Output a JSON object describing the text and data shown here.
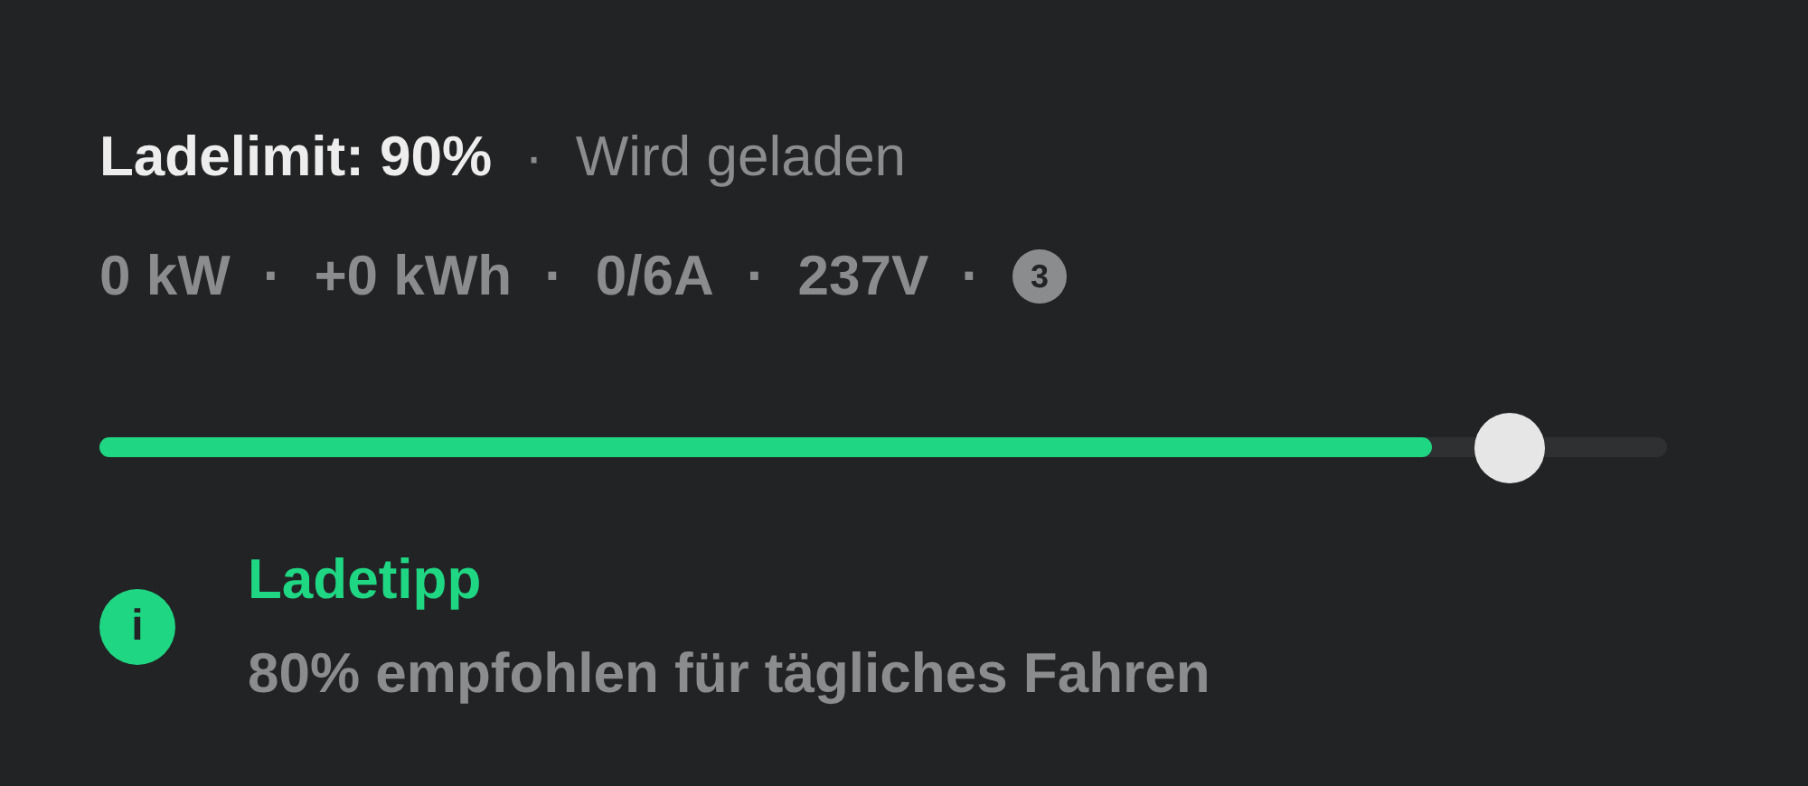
{
  "status": {
    "limit": "Ladelimit: 90%",
    "separator": "·",
    "state": "Wird geladen"
  },
  "stats": [
    {
      "kind": "text",
      "text": "0 kW"
    },
    {
      "kind": "text",
      "text": "+0 kWh"
    },
    {
      "kind": "text",
      "text": "0/6A"
    },
    {
      "kind": "text",
      "text": "237V"
    },
    {
      "kind": "badge",
      "text": "3"
    }
  ],
  "stats_separator": "·",
  "slider": {
    "charge": {
      "level": 0.85
    },
    "limit": {
      "level": 0.9
    }
  },
  "tip": {
    "icon": "i",
    "title": "Ladetipp",
    "text": "80% empfohlen für tägliches Fahren"
  }
}
